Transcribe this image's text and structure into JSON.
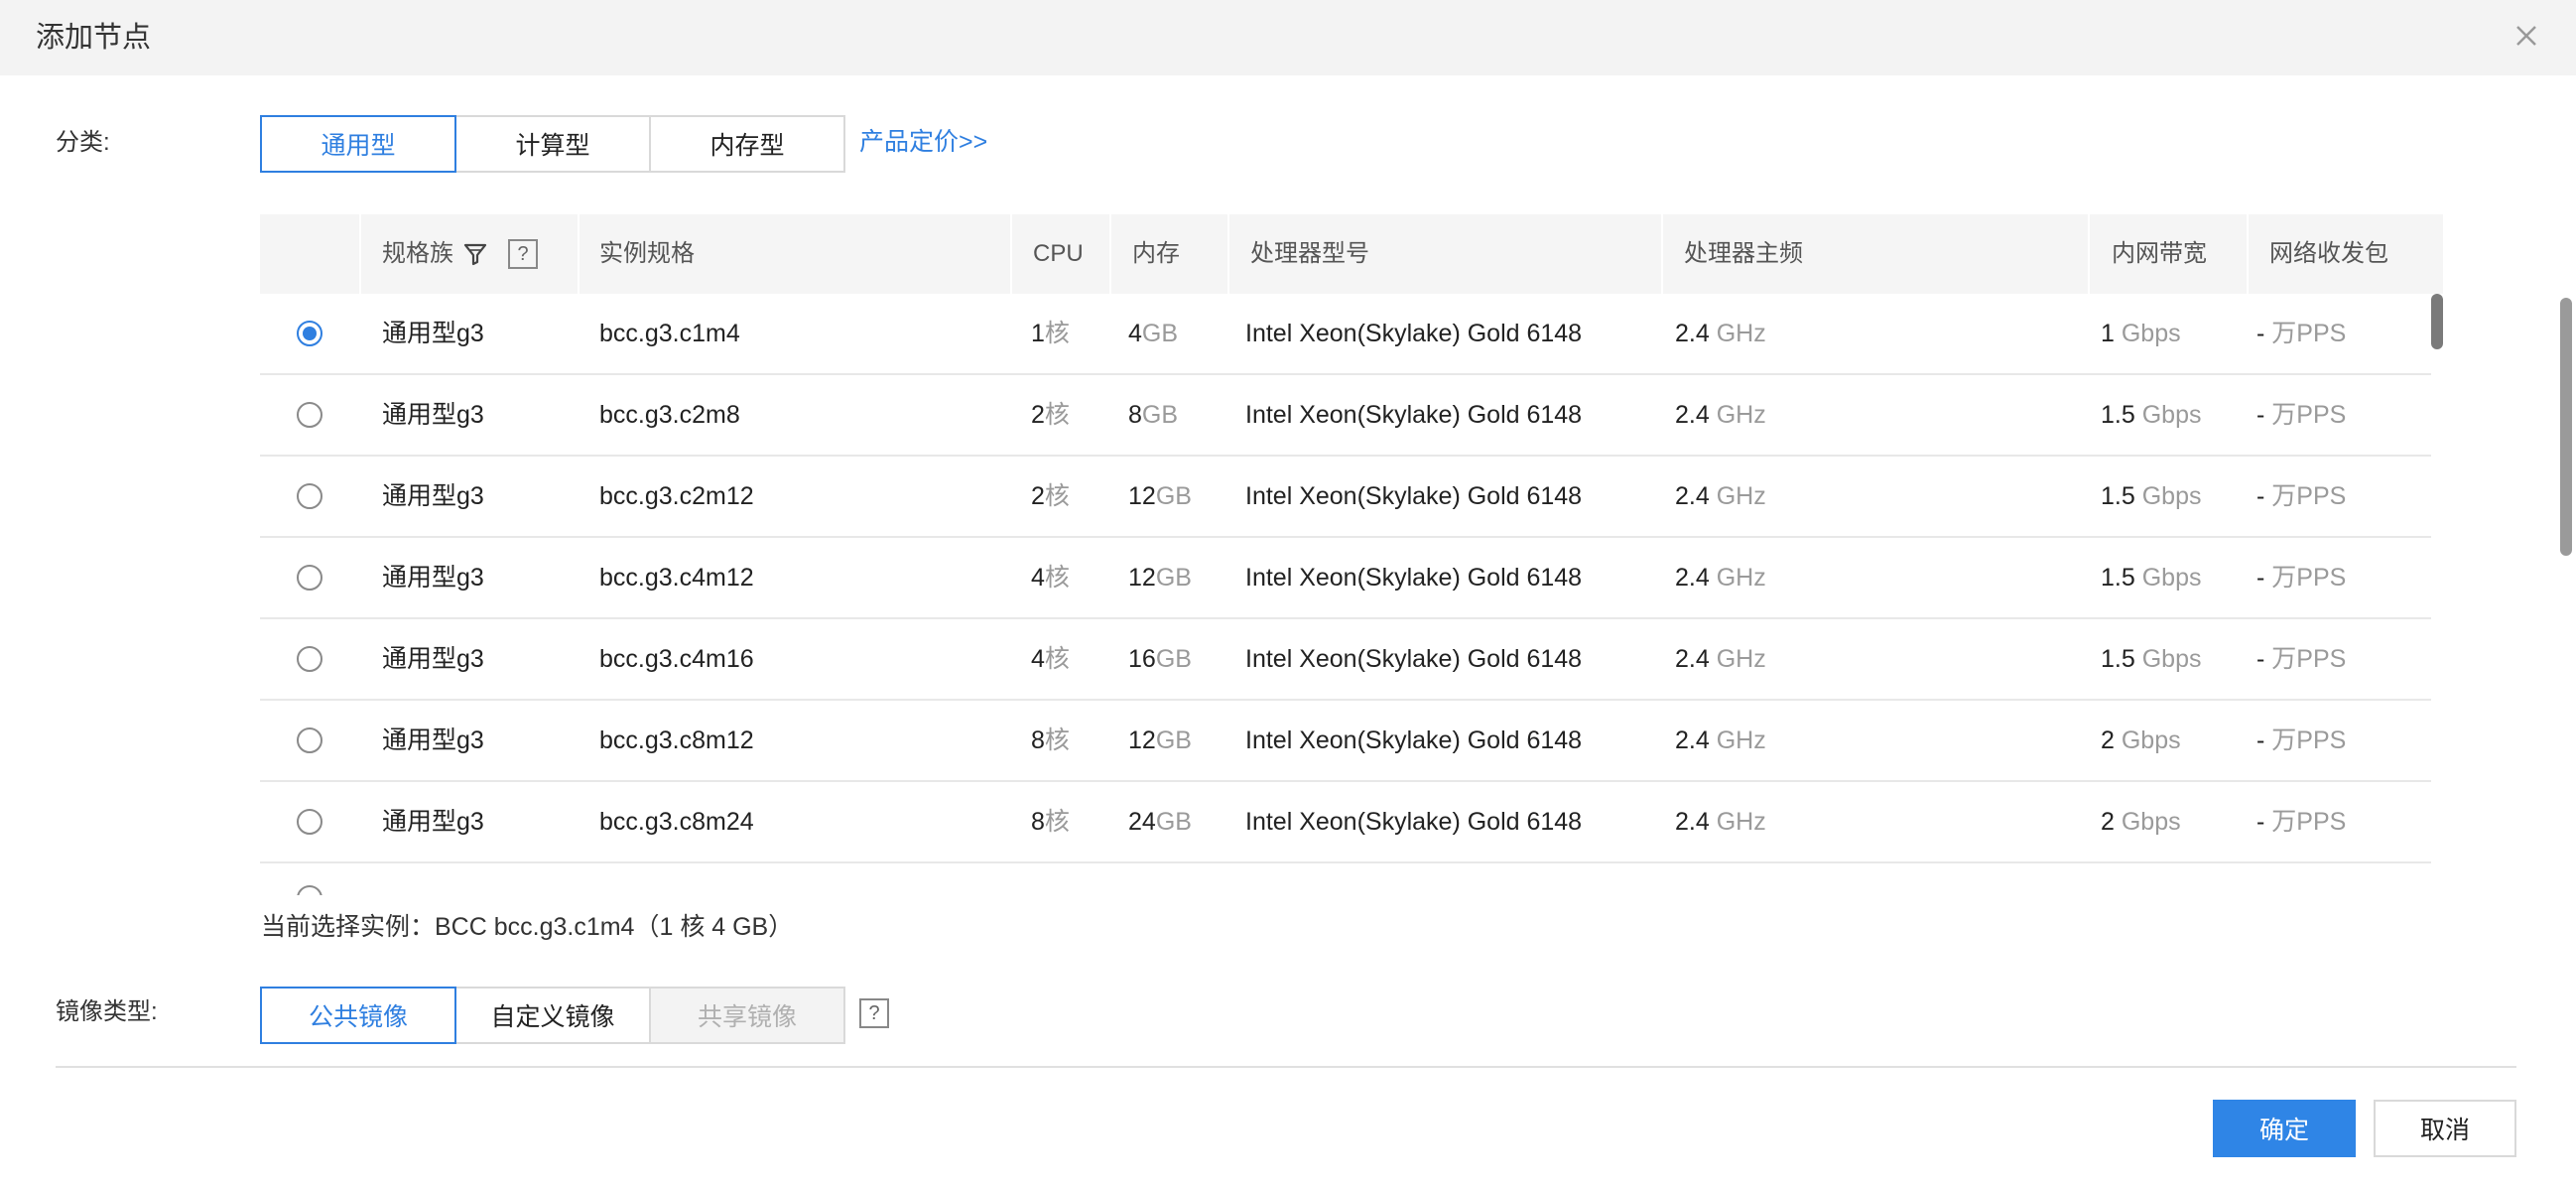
{
  "dialog": {
    "title": "添加节点",
    "close_icon": "close-icon"
  },
  "category": {
    "label": "分类:",
    "tabs": [
      "通用型",
      "计算型",
      "内存型"
    ],
    "active_index": 0,
    "pricing_link": "产品定价>>"
  },
  "table": {
    "headers": {
      "family": "规格族",
      "spec": "实例规格",
      "cpu": "CPU",
      "memory": "内存",
      "processor": "处理器型号",
      "frequency": "处理器主频",
      "bandwidth": "内网带宽",
      "pps": "网络收发包"
    },
    "filter_icon": "filter-icon",
    "help_icon_text": "?",
    "selected_row": 0,
    "rows": [
      {
        "family": "通用型g3",
        "spec": "bcc.g3.c1m4",
        "cpu": "1",
        "cpu_unit": "核",
        "mem": "4",
        "mem_unit": "GB",
        "processor": "Intel Xeon(Skylake) Gold 6148",
        "freq": "2.4",
        "freq_unit": "GHz",
        "bw": "1",
        "bw_unit": "Gbps",
        "pps": "-",
        "pps_unit": "万PPS"
      },
      {
        "family": "通用型g3",
        "spec": "bcc.g3.c2m8",
        "cpu": "2",
        "cpu_unit": "核",
        "mem": "8",
        "mem_unit": "GB",
        "processor": "Intel Xeon(Skylake) Gold 6148",
        "freq": "2.4",
        "freq_unit": "GHz",
        "bw": "1.5",
        "bw_unit": "Gbps",
        "pps": "-",
        "pps_unit": "万PPS"
      },
      {
        "family": "通用型g3",
        "spec": "bcc.g3.c2m12",
        "cpu": "2",
        "cpu_unit": "核",
        "mem": "12",
        "mem_unit": "GB",
        "processor": "Intel Xeon(Skylake) Gold 6148",
        "freq": "2.4",
        "freq_unit": "GHz",
        "bw": "1.5",
        "bw_unit": "Gbps",
        "pps": "-",
        "pps_unit": "万PPS"
      },
      {
        "family": "通用型g3",
        "spec": "bcc.g3.c4m12",
        "cpu": "4",
        "cpu_unit": "核",
        "mem": "12",
        "mem_unit": "GB",
        "processor": "Intel Xeon(Skylake) Gold 6148",
        "freq": "2.4",
        "freq_unit": "GHz",
        "bw": "1.5",
        "bw_unit": "Gbps",
        "pps": "-",
        "pps_unit": "万PPS"
      },
      {
        "family": "通用型g3",
        "spec": "bcc.g3.c4m16",
        "cpu": "4",
        "cpu_unit": "核",
        "mem": "16",
        "mem_unit": "GB",
        "processor": "Intel Xeon(Skylake) Gold 6148",
        "freq": "2.4",
        "freq_unit": "GHz",
        "bw": "1.5",
        "bw_unit": "Gbps",
        "pps": "-",
        "pps_unit": "万PPS"
      },
      {
        "family": "通用型g3",
        "spec": "bcc.g3.c8m12",
        "cpu": "8",
        "cpu_unit": "核",
        "mem": "12",
        "mem_unit": "GB",
        "processor": "Intel Xeon(Skylake) Gold 6148",
        "freq": "2.4",
        "freq_unit": "GHz",
        "bw": "2",
        "bw_unit": "Gbps",
        "pps": "-",
        "pps_unit": "万PPS"
      },
      {
        "family": "通用型g3",
        "spec": "bcc.g3.c8m24",
        "cpu": "8",
        "cpu_unit": "核",
        "mem": "24",
        "mem_unit": "GB",
        "processor": "Intel Xeon(Skylake) Gold 6148",
        "freq": "2.4",
        "freq_unit": "GHz",
        "bw": "2",
        "bw_unit": "Gbps",
        "pps": "-",
        "pps_unit": "万PPS"
      }
    ]
  },
  "current_selection": "当前选择实例：BCC bcc.g3.c1m4（1 核 4 GB）",
  "image_type": {
    "label": "镜像类型:",
    "tabs": [
      "公共镜像",
      "自定义镜像",
      "共享镜像"
    ],
    "active_index": 0,
    "disabled_index": 2,
    "help_icon_text": "?"
  },
  "footer": {
    "ok_label": "确定",
    "cancel_label": "取消"
  },
  "colors": {
    "accent": "#2f7fe0",
    "primary_button": "#2f85e6",
    "header_bg": "#f3f3f3"
  }
}
